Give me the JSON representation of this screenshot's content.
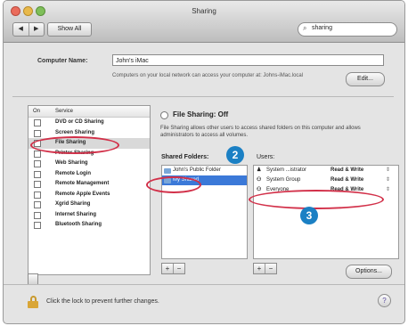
{
  "window": {
    "title": "Sharing"
  },
  "toolbar": {
    "back_label": "◀",
    "forward_label": "▶",
    "show_all_label": "Show All",
    "search_value": "sharing",
    "search_icon": "magnifier"
  },
  "computer_name": {
    "label": "Computer Name:",
    "value": "John's iMac",
    "description": "Computers on your local network can access your computer at: Johns-iMac.local",
    "edit_label": "Edit..."
  },
  "services": {
    "header_on": "On",
    "header_service": "Service",
    "items": [
      {
        "label": "DVD or CD Sharing"
      },
      {
        "label": "Screen Sharing"
      },
      {
        "label": "File Sharing"
      },
      {
        "label": "Printer Sharing"
      },
      {
        "label": "Web Sharing"
      },
      {
        "label": "Remote Login"
      },
      {
        "label": "Remote Management"
      },
      {
        "label": "Remote Apple Events"
      },
      {
        "label": "Xgrid Sharing"
      },
      {
        "label": "Internet Sharing"
      },
      {
        "label": "Bluetooth Sharing"
      }
    ]
  },
  "file_sharing": {
    "status": "File Sharing: Off",
    "description": "File Sharing allows other users to access shared folders on this computer and allows administrators to access all volumes.",
    "shared_folders_label": "Shared Folders:",
    "users_label": "Users:",
    "folders": [
      {
        "label": "John's Public Folder"
      },
      {
        "label": "My Shared"
      }
    ],
    "users": [
      {
        "icon": "person-icon",
        "name": "System ...istrator",
        "permission": "Read & Write"
      },
      {
        "icon": "group-icon",
        "name": "System Group",
        "permission": "Read & Write"
      },
      {
        "icon": "group-icon",
        "name": "Everyone",
        "permission": "Read & Write"
      }
    ],
    "plus": "+",
    "minus": "−",
    "options_label": "Options..."
  },
  "footer": {
    "lock_text": "Click the lock to prevent further changes.",
    "help_label": "?"
  },
  "callouts": {
    "badge2": "2",
    "badge3": "3"
  },
  "colors": {
    "annotation": "#d23049",
    "badge": "#1b80c4",
    "selection": "#3b79d8"
  }
}
